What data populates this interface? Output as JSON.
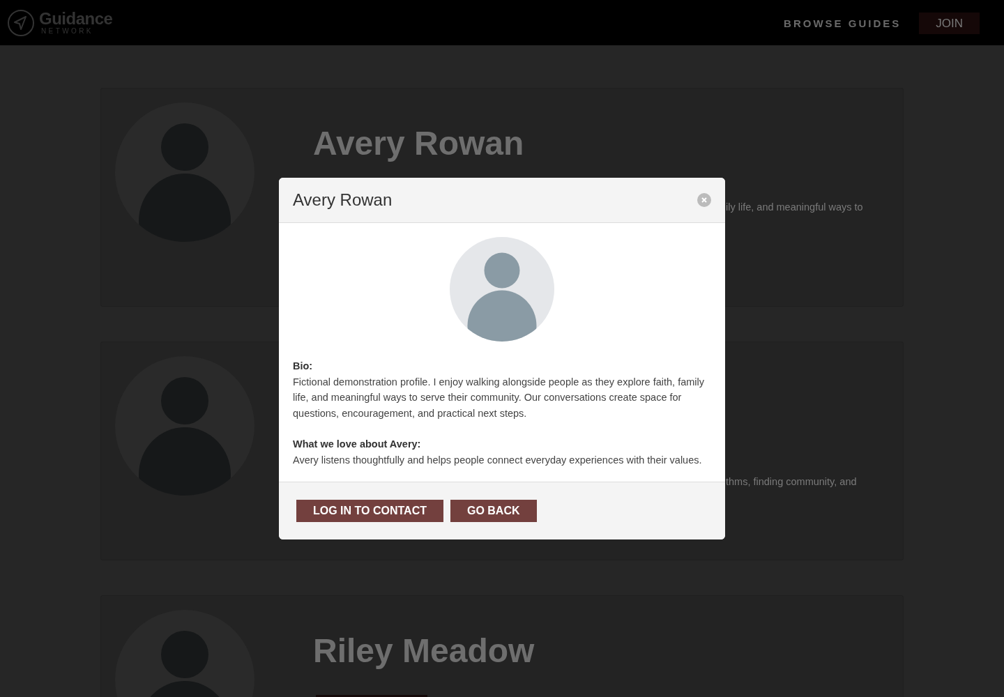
{
  "header": {
    "logo": {
      "name": "Guidance",
      "tagline": "NETWORK"
    },
    "nav": [
      {
        "label": "BROWSE GUIDES",
        "kind": "link"
      },
      {
        "label": "JOIN",
        "kind": "button"
      }
    ]
  },
  "profiles": [
    {
      "name": "Avery Rowan",
      "bio_fragment": "ily life, and meaningful ways to",
      "has_button": false
    },
    {
      "bio_fragment": "thms, finding community, and",
      "has_button": false
    },
    {
      "name": "Riley Meadow",
      "has_button": true
    }
  ],
  "modal": {
    "title": "Avery Rowan",
    "bio_label": "Bio:",
    "bio": "Fictional demonstration profile. I enjoy walking alongside people as they explore faith, family life, and meaningful ways to serve their community. Our conversations create space for questions, encouragement, and practical next steps.",
    "love_label": "What we love about Avery:",
    "love": "Avery listens thoughtfully and helps people connect everyday experiences with their values.",
    "buttons": [
      "LOG IN TO CONTACT",
      "GO BACK"
    ]
  }
}
